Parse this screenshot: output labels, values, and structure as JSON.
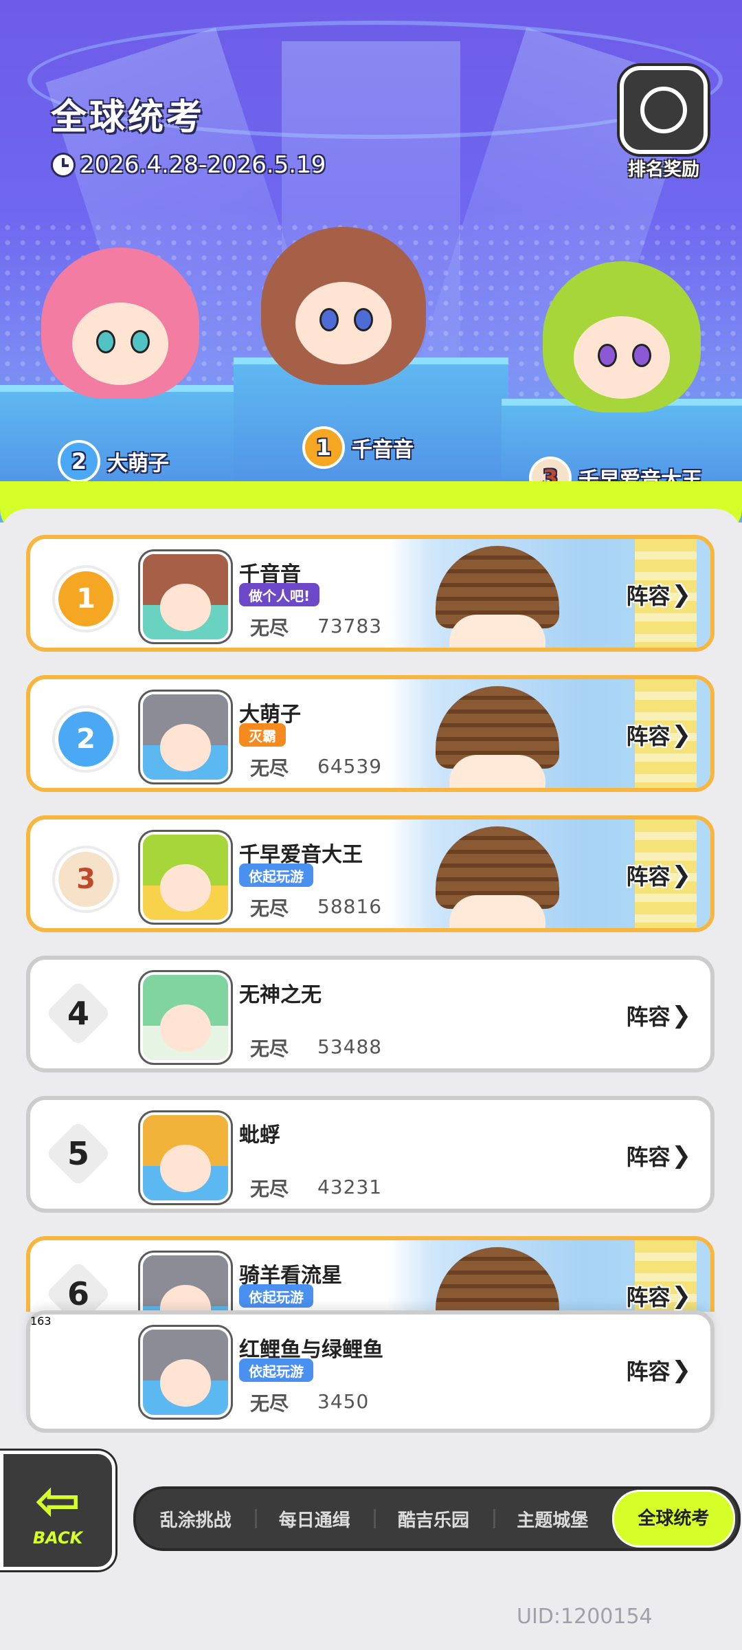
{
  "header": {
    "title": "全球统考",
    "date_range": "2026.4.28-2026.5.19",
    "reward_label": "排名奖励"
  },
  "podium": [
    {
      "rank": "1",
      "name": "千音音"
    },
    {
      "rank": "2",
      "name": "大萌子"
    },
    {
      "rank": "3",
      "name": "千早爱音大王"
    }
  ],
  "leaderboard": [
    {
      "rank": "1",
      "name": "千音音",
      "tag": "做个人吧!",
      "mode": "无尽",
      "score": "73783",
      "lineup": "阵容"
    },
    {
      "rank": "2",
      "name": "大萌子",
      "tag": "灭霸",
      "mode": "无尽",
      "score": "64539",
      "lineup": "阵容"
    },
    {
      "rank": "3",
      "name": "千早爱音大王",
      "tag": "依起玩游",
      "mode": "无尽",
      "score": "58816",
      "lineup": "阵容"
    },
    {
      "rank": "4",
      "name": "无神之无",
      "tag": "",
      "mode": "无尽",
      "score": "53488",
      "lineup": "阵容"
    },
    {
      "rank": "5",
      "name": "蚍蜉",
      "tag": "",
      "mode": "无尽",
      "score": "43231",
      "lineup": "阵容"
    },
    {
      "rank": "6",
      "name": "骑羊看流星",
      "tag": "依起玩游",
      "mode": "",
      "score": "",
      "lineup": "阵容"
    }
  ],
  "my_entry": {
    "rank": "163",
    "name": "红鲤鱼与绿鲤鱼",
    "tag": "依起玩游",
    "mode": "无尽",
    "score": "3450",
    "lineup": "阵容"
  },
  "tabs": [
    "乱涂挑战",
    "每日通缉",
    "酷吉乐园",
    "主题城堡",
    "全球统考"
  ],
  "active_tab": "全球统考",
  "back_label": "BACK",
  "uid": "UID:1200154",
  "colors": {
    "accent_lime": "#d6ff2a",
    "gold_border": "#f6b640",
    "dark_bar": "#3b3b3b"
  }
}
